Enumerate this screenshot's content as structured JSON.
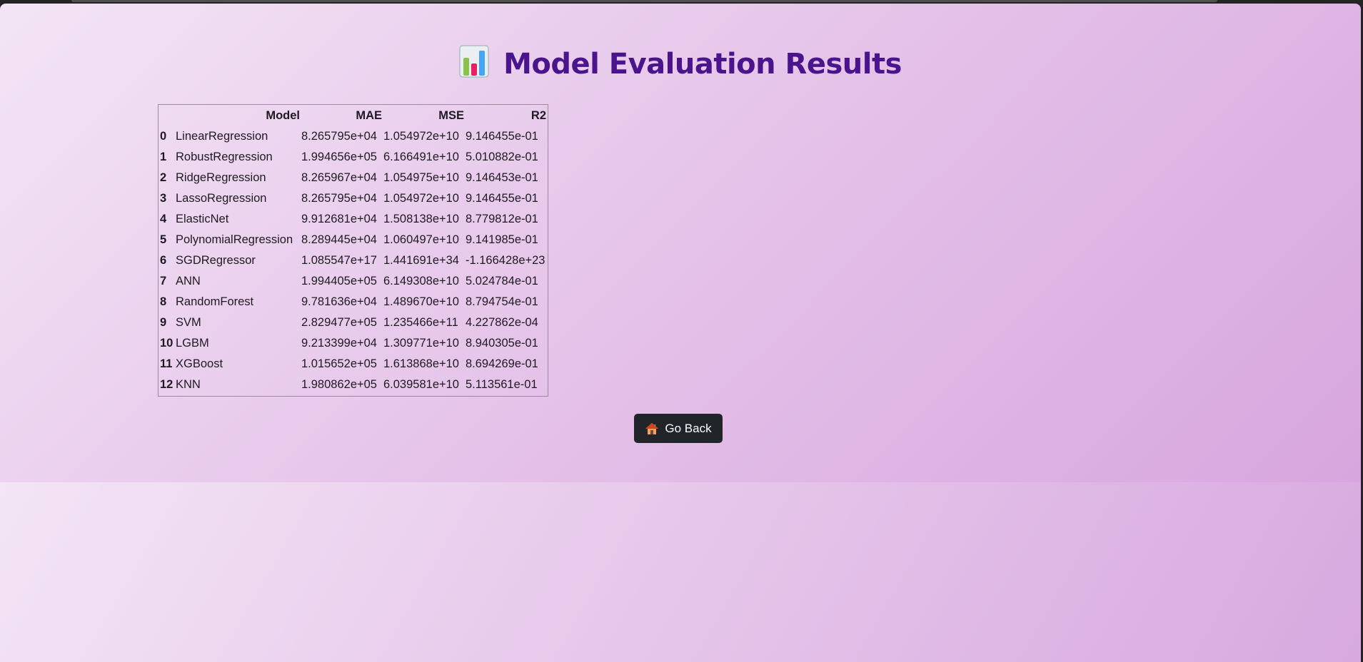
{
  "page": {
    "title": "Model Evaluation Results",
    "title_icon": "bar-chart-icon",
    "title_color": "#4a148c"
  },
  "table": {
    "columns": [
      "",
      "Model",
      "MAE",
      "MSE",
      "R2"
    ],
    "rows": [
      {
        "index": "0",
        "model": "LinearRegression",
        "mae": "8.265795e+04",
        "mse": "1.054972e+10",
        "r2": "9.146455e-01"
      },
      {
        "index": "1",
        "model": "RobustRegression",
        "mae": "1.994656e+05",
        "mse": "6.166491e+10",
        "r2": "5.010882e-01"
      },
      {
        "index": "2",
        "model": "RidgeRegression",
        "mae": "8.265967e+04",
        "mse": "1.054975e+10",
        "r2": "9.146453e-01"
      },
      {
        "index": "3",
        "model": "LassoRegression",
        "mae": "8.265795e+04",
        "mse": "1.054972e+10",
        "r2": "9.146455e-01"
      },
      {
        "index": "4",
        "model": "ElasticNet",
        "mae": "9.912681e+04",
        "mse": "1.508138e+10",
        "r2": "8.779812e-01"
      },
      {
        "index": "5",
        "model": "PolynomialRegression",
        "mae": "8.289445e+04",
        "mse": "1.060497e+10",
        "r2": "9.141985e-01"
      },
      {
        "index": "6",
        "model": "SGDRegressor",
        "mae": "1.085547e+17",
        "mse": "1.441691e+34",
        "r2": "-1.166428e+23"
      },
      {
        "index": "7",
        "model": "ANN",
        "mae": "1.994405e+05",
        "mse": "6.149308e+10",
        "r2": "5.024784e-01"
      },
      {
        "index": "8",
        "model": "RandomForest",
        "mae": "9.781636e+04",
        "mse": "1.489670e+10",
        "r2": "8.794754e-01"
      },
      {
        "index": "9",
        "model": "SVM",
        "mae": "2.829477e+05",
        "mse": "1.235466e+11",
        "r2": "4.227862e-04"
      },
      {
        "index": "10",
        "model": "LGBM",
        "mae": "9.213399e+04",
        "mse": "1.309771e+10",
        "r2": "8.940305e-01"
      },
      {
        "index": "11",
        "model": "XGBoost",
        "mae": "1.015652e+05",
        "mse": "1.613868e+10",
        "r2": "8.694269e-01"
      },
      {
        "index": "12",
        "model": "KNN",
        "mae": "1.980862e+05",
        "mse": "6.039581e+10",
        "r2": "5.113561e-01"
      }
    ]
  },
  "back_button": {
    "label": "Go Back",
    "icon": "house-icon",
    "background": "#212529"
  }
}
